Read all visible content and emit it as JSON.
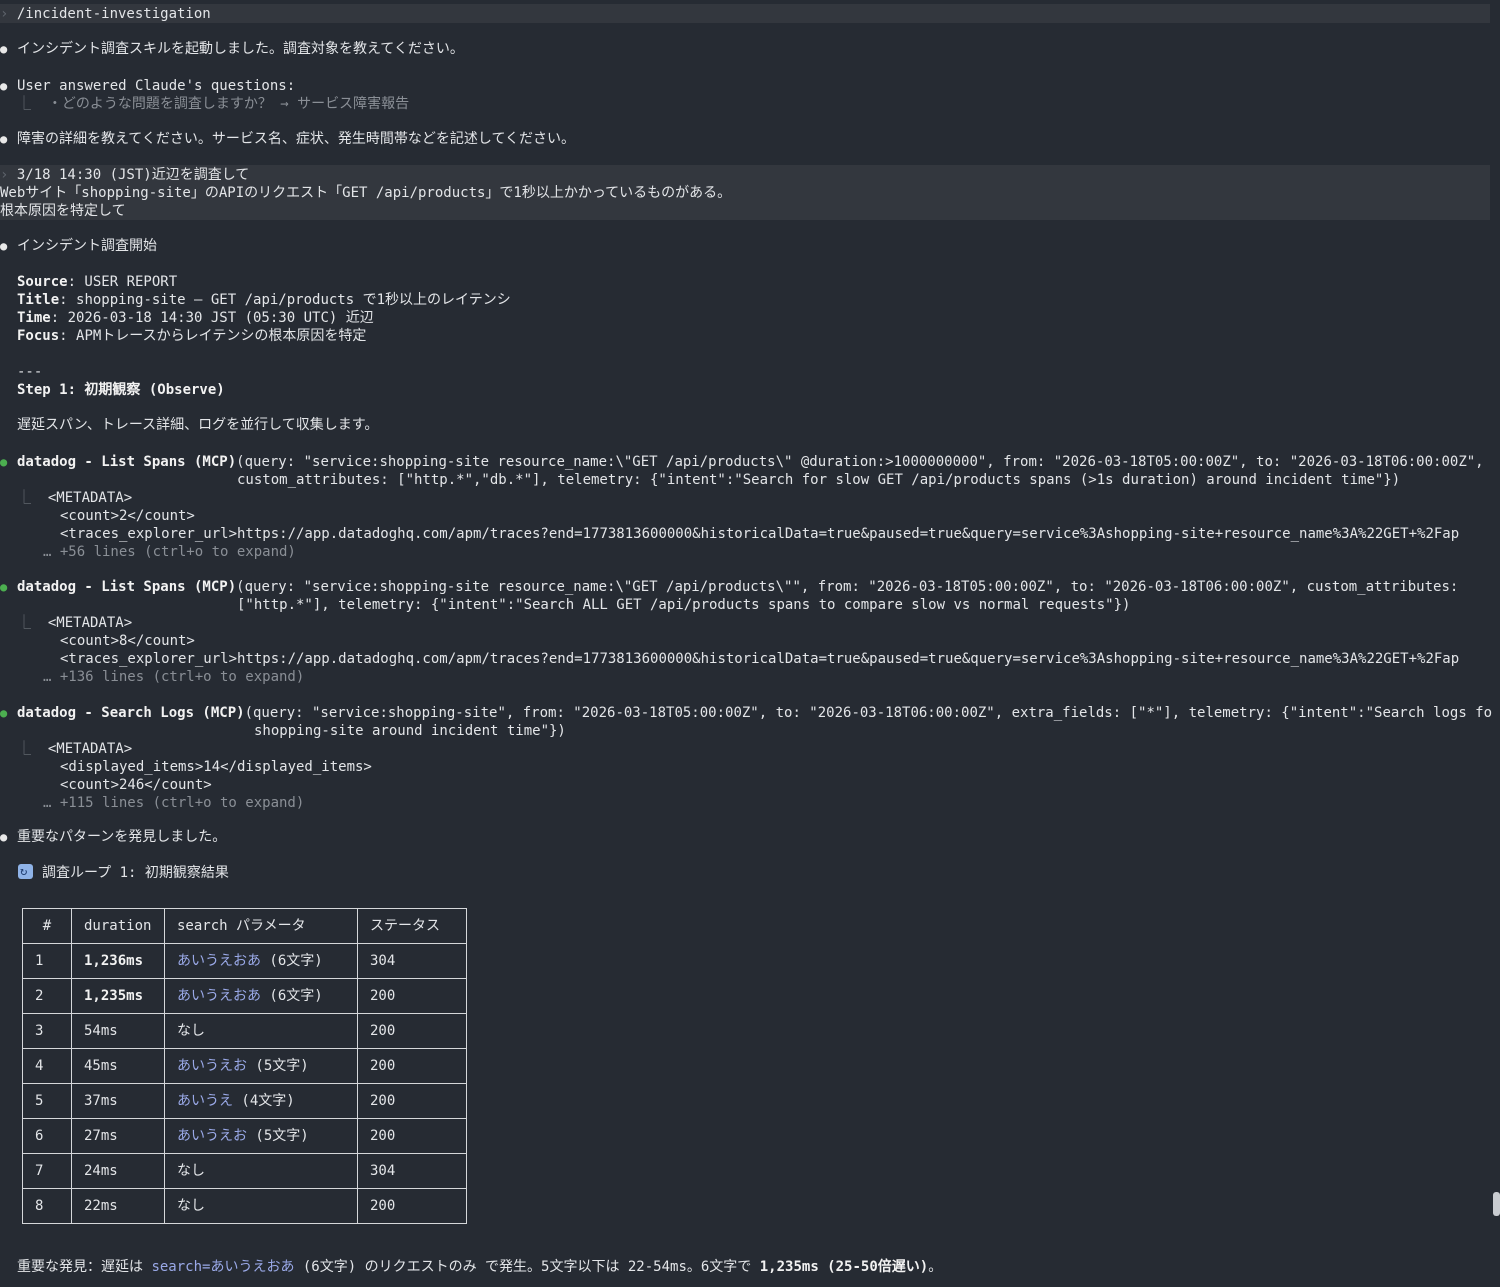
{
  "command": "/incident-investigation",
  "msg_skill": "インシデント調査スキルを起動しました。調査対象を教えてください。",
  "user_answered": {
    "title": "User answered Claude's questions:",
    "qa": "・どのような問題を調査しますか？ → サービス障害報告"
  },
  "msg_details": "障害の詳細を教えてください。サービス名、症状、発生時間帯などを記述してください。",
  "user_prompt": [
    "3/18 14:30 (JST)近辺を調査して",
    "Webサイト「shopping-site」のAPIのリクエスト「GET /api/products」で1秒以上かかっているものがある。",
    "根本原因を特定して"
  ],
  "msg_start": "インシデント調査開始",
  "report": {
    "source_label": "Source",
    "source_value": ": USER REPORT",
    "title_label": "Title",
    "title_value": ": shopping-site — GET /api/products で1秒以上のレイテンシ",
    "time_label": "Time",
    "time_value": ": 2026-03-18 14:30 JST (05:30 UTC) 近辺",
    "focus_label": "Focus",
    "focus_value": ": APMトレースからレイテンシの根本原因を特定"
  },
  "separator": "---",
  "step1": "Step 1: 初期観察 (Observe)",
  "step1_desc": "遅延スパン、トレース詳細、ログを並行して収集します。",
  "tool_calls": [
    {
      "name": "datadog - List Spans (MCP)",
      "args1": "(query: \"service:shopping-site resource_name:\\\"GET /api/products\\\" @duration:>1000000000\", from: \"2026-03-18T05:00:00Z\", to: \"2026-03-18T06:00:00Z\",",
      "args2": "custom_attributes: [\"http.*\",\"db.*\"], telemetry: {\"intent\":\"Search for slow GET /api/products spans (>1s duration) around incident time\"})",
      "out": [
        "<METADATA>",
        "<count>2</count>",
        "<traces_explorer_url>https://app.datadoghq.com/apm/traces?end=1773813600000&historicalData=true&paused=true&query=service%3Ashopping-site+resource_name%3A%22GET+%2Fap"
      ],
      "more": "… +56 lines (ctrl+o to expand)"
    },
    {
      "name": "datadog - List Spans (MCP)",
      "args1": "(query: \"service:shopping-site resource_name:\\\"GET /api/products\\\"\", from: \"2026-03-18T05:00:00Z\", to: \"2026-03-18T06:00:00Z\", custom_attributes:",
      "args2": "[\"http.*\"], telemetry: {\"intent\":\"Search ALL GET /api/products spans to compare slow vs normal requests\"})",
      "out": [
        "<METADATA>",
        "<count>8</count>",
        "<traces_explorer_url>https://app.datadoghq.com/apm/traces?end=1773813600000&historicalData=true&paused=true&query=service%3Ashopping-site+resource_name%3A%22GET+%2Fap"
      ],
      "more": "… +136 lines (ctrl+o to expand)"
    },
    {
      "name": "datadog - Search Logs (MCP)",
      "args1": "(query: \"service:shopping-site\", from: \"2026-03-18T05:00:00Z\", to: \"2026-03-18T06:00:00Z\", extra_fields: [\"*\"], telemetry: {\"intent\":\"Search logs fo",
      "args2": "shopping-site around incident time\"})",
      "out": [
        "<METADATA>",
        "<displayed_items>14</displayed_items>",
        "<count>246</count>"
      ],
      "more": "… +115 lines (ctrl+o to expand)"
    }
  ],
  "msg_pattern": "重要なパターンを発見しました。",
  "loop_title": "調査ループ 1: 初期観察結果",
  "table": {
    "headers": [
      "#",
      "duration",
      "search パラメータ",
      "ステータス"
    ],
    "rows": [
      {
        "n": "1",
        "duration": "1,236ms",
        "bold": true,
        "param": "あいうえおあ",
        "len": " (6文字)",
        "status": "304"
      },
      {
        "n": "2",
        "duration": "1,235ms",
        "bold": true,
        "param": "あいうえおあ",
        "len": " (6文字)",
        "status": "200"
      },
      {
        "n": "3",
        "duration": "54ms",
        "bold": false,
        "param": "",
        "len": "なし",
        "status": "200"
      },
      {
        "n": "4",
        "duration": "45ms",
        "bold": false,
        "param": "あいうえお",
        "len": " (5文字)",
        "status": "200"
      },
      {
        "n": "5",
        "duration": "37ms",
        "bold": false,
        "param": "あいうえ",
        "len": " (4文字)",
        "status": "200"
      },
      {
        "n": "6",
        "duration": "27ms",
        "bold": false,
        "param": "あいうえお",
        "len": " (5文字)",
        "status": "200"
      },
      {
        "n": "7",
        "duration": "24ms",
        "bold": false,
        "param": "",
        "len": "なし",
        "status": "304"
      },
      {
        "n": "8",
        "duration": "22ms",
        "bold": false,
        "param": "",
        "len": "なし",
        "status": "200"
      }
    ]
  },
  "finding": {
    "prefix": "重要な発見：遅延は ",
    "highlight": "search=あいうえおあ",
    "middle": " (6文字) のリクエストのみ で発生。5文字以下は 22-54ms。6文字で ",
    "bold": "1,235ms (25-50倍遅い)",
    "suffix": "。"
  }
}
